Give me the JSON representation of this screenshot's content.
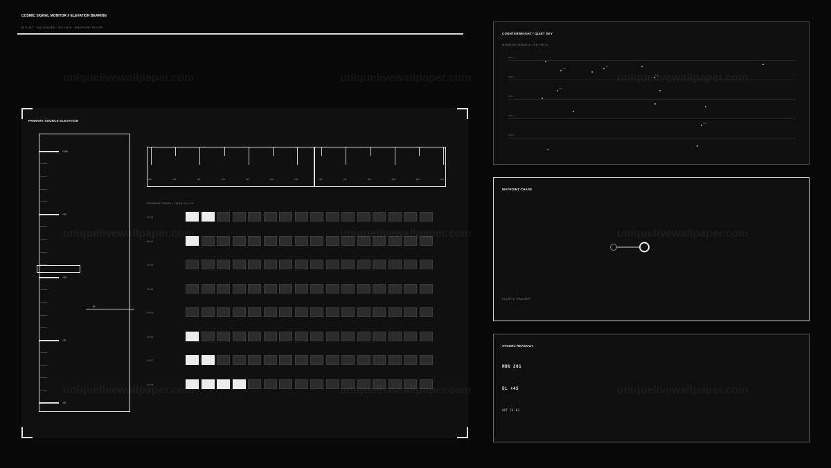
{
  "header": {
    "title": "COSMIC SIGNAL MONITOR // ELEVATION BEARING",
    "subtitle": "ELV 347 · 030 LOADED · ALT 0470 · WAYPOINT SLICED"
  },
  "main": {
    "title": "PRIMARY SOURCE ELEVATION",
    "elevation_scale": [
      "+150",
      "+90",
      "+30",
      "-30",
      "-90"
    ],
    "el_tag": "EL",
    "ruler_labels": [
      "090",
      "100",
      "110",
      "120",
      "130",
      "140",
      "150",
      "160",
      "170",
      "180",
      "190",
      "200",
      "210"
    ],
    "segment_title": "SEGMENT BANK / LOCK CELLS",
    "segments": [
      {
        "label": "CH 01",
        "lit": 2
      },
      {
        "label": "CH 02",
        "lit": 1
      },
      {
        "label": "CH 03",
        "lit": 0
      },
      {
        "label": "CH 04",
        "lit": 0
      },
      {
        "label": "CH 05",
        "lit": 0
      },
      {
        "label": "CH 06",
        "lit": 1
      },
      {
        "label": "CH 07",
        "lit": 2
      },
      {
        "label": "CH 08",
        "lit": 4
      }
    ],
    "cells_per_row": 16
  },
  "sky": {
    "title": "COUNTERWEIGHT  /  QUIET SKY",
    "subtitle": "MONITOR SPACE & THE FIELD",
    "bands": [
      "BAN 1",
      "BAN 2",
      "BAN 3",
      "BAN 4",
      "BAN 5"
    ],
    "star_labels": [
      "A01",
      "A02",
      "A03",
      "A04",
      "A05"
    ]
  },
  "chase": {
    "title": "WAYPOINT CHASE",
    "footer": "ELASTIC TRACKER"
  },
  "readout": {
    "title": "AVIONIC READOUT",
    "heading": "HDG  201",
    "elevation": "EL  +45",
    "waypoint": "WPT  CS-03"
  },
  "watermark": "uniquelivewallpaper.com"
}
